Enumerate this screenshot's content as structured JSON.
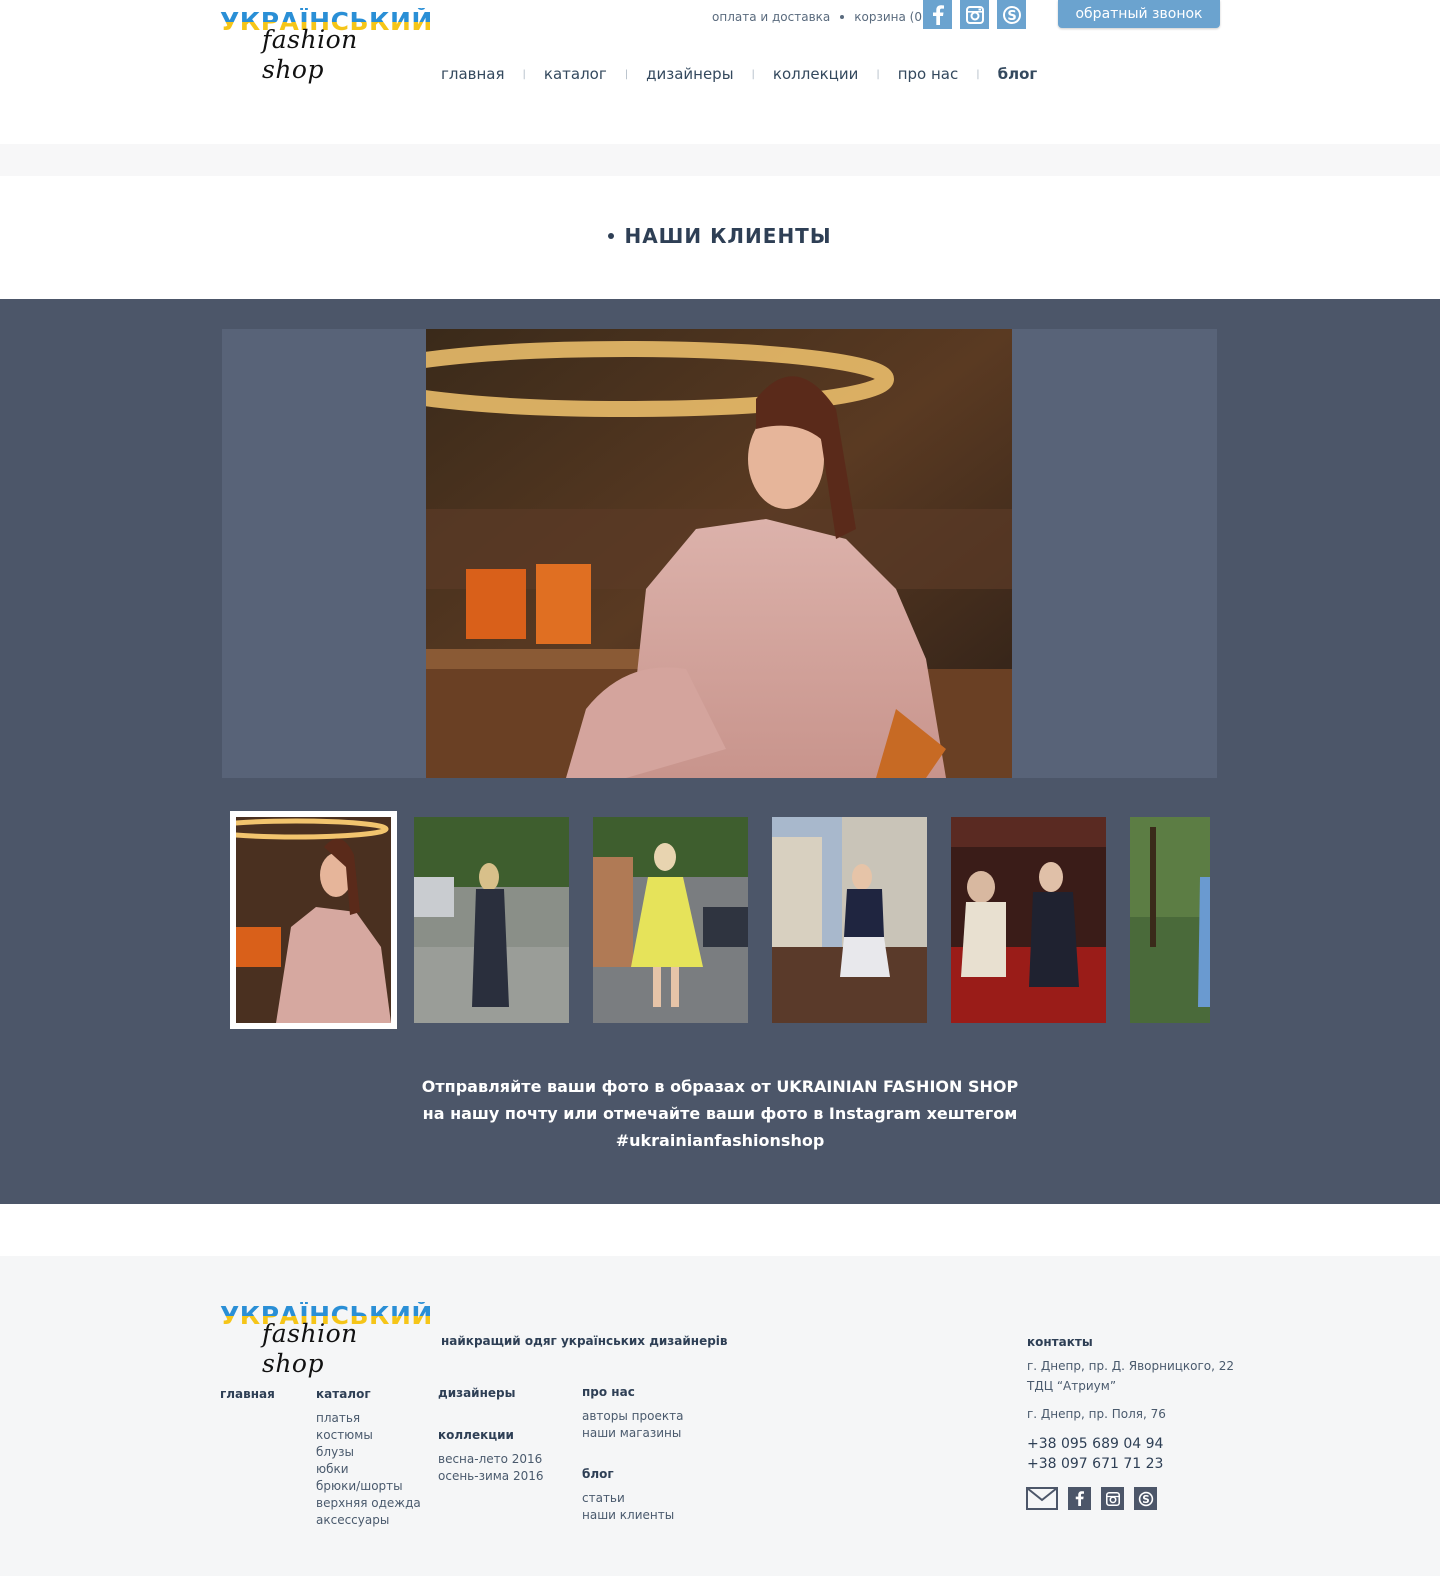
{
  "brand": {
    "logo_top": "УКРАЇНСЬКИЙ",
    "logo_bottom": "fashion shop"
  },
  "header": {
    "top_links": [
      "оплата и доставка",
      "корзина (0)"
    ],
    "callback_label": "обратный звонок",
    "social_icons": [
      "facebook-icon",
      "instagram-icon",
      "skype-icon"
    ],
    "nav": [
      {
        "label": "главная",
        "active": false
      },
      {
        "label": "каталог",
        "active": false
      },
      {
        "label": "дизайнеры",
        "active": false
      },
      {
        "label": "коллекции",
        "active": false
      },
      {
        "label": "про нас",
        "active": false
      },
      {
        "label": "блог",
        "active": true
      }
    ],
    "nav_separator": "|"
  },
  "page": {
    "title": "НАШИ КЛИЕНТЫ"
  },
  "gallery": {
    "selected_index": 0,
    "caption_lines": [
      "Отправляйте ваши фото в образах от UKRAINIAN FASHION SHOP",
      "на нашу почту или отмечайте ваши фото в Instagram хештегом",
      "#ukrainianfashionshop"
    ]
  },
  "footer": {
    "tagline": "найкращий одяг українських дизайнерів",
    "columns": {
      "home": {
        "head": "главная"
      },
      "catalog": {
        "head": "каталог",
        "links": [
          "платья",
          "костюмы",
          "блузы",
          "юбки",
          "брюки/шорты",
          "верхняя одежда",
          "аксессуары"
        ]
      },
      "designers": {
        "head": "дизайнеры"
      },
      "collections": {
        "head": "коллекции",
        "links": [
          "весна-лето 2016",
          "осень-зима 2016"
        ]
      },
      "about": {
        "head": "про нас",
        "links": [
          "авторы проекта",
          "наши магазины"
        ]
      },
      "blog": {
        "head": "блог",
        "links": [
          "статьи",
          "наши клиенты"
        ]
      }
    },
    "contacts": {
      "head": "контакты",
      "address1": "г. Днепр, пр. Д. Яворницкого, 22",
      "address1b": "ТДЦ “Атриум”",
      "address2": "г. Днепр, пр. Поля, 76",
      "phone1": "+38 095 689 04 94",
      "phone2": "+38 097 671 71 23"
    },
    "icons": [
      "mail-icon",
      "facebook-icon",
      "instagram-icon",
      "skype-icon"
    ]
  },
  "colors": {
    "accent": "#6ba3cf",
    "gallery_bg": "#4c5669",
    "text_dark": "#2e3f55",
    "footer_bg": "#f5f6f7"
  }
}
